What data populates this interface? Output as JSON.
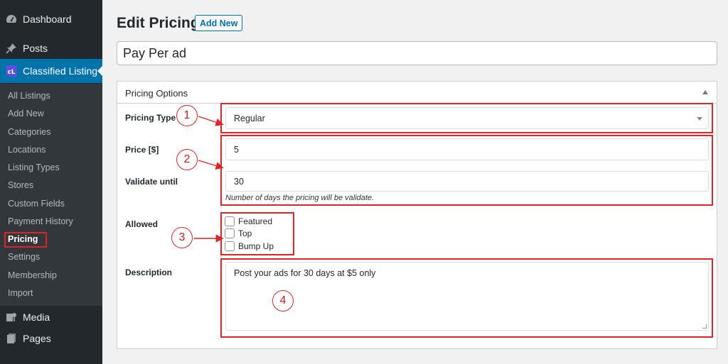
{
  "sidebar": {
    "top_items": [
      {
        "label": "Dashboard",
        "icon": "dashboard-icon"
      },
      {
        "label": "Posts",
        "icon": "pin-icon"
      },
      {
        "label": "Classified Listing",
        "icon": "classified-listing-logo"
      }
    ],
    "submenu": [
      "All Listings",
      "Add New",
      "Categories",
      "Locations",
      "Listing Types",
      "Stores",
      "Custom Fields",
      "Payment History",
      "Pricing",
      "Settings",
      "Membership",
      "Import"
    ],
    "current": "Pricing",
    "bottom_items": [
      {
        "label": "Media",
        "icon": "media-icon"
      },
      {
        "label": "Pages",
        "icon": "pages-icon"
      }
    ],
    "logo_text": "cL"
  },
  "header": {
    "title": "Edit Pricing",
    "add_new": "Add New"
  },
  "post_title": "Pay Per ad",
  "pricing_options": {
    "title": "Pricing Options",
    "pricing_type": {
      "label": "Pricing Type",
      "value": "Regular"
    },
    "price": {
      "label": "Price [$]",
      "value": "5"
    },
    "validate": {
      "label": "Validate until",
      "value": "30",
      "hint": "Number of days the pricing will be validate."
    },
    "allowed": {
      "label": "Allowed",
      "options": [
        "Featured",
        "Top",
        "Bump Up"
      ]
    },
    "description": {
      "label": "Description",
      "value": "Post your ads for 30 days at $5 only"
    }
  },
  "annotations": [
    "1",
    "2",
    "3",
    "4"
  ],
  "colors": {
    "sidebar": "#23282d",
    "submenu": "#32373c",
    "accent": "#0073aa",
    "annotation": "#e02424"
  }
}
